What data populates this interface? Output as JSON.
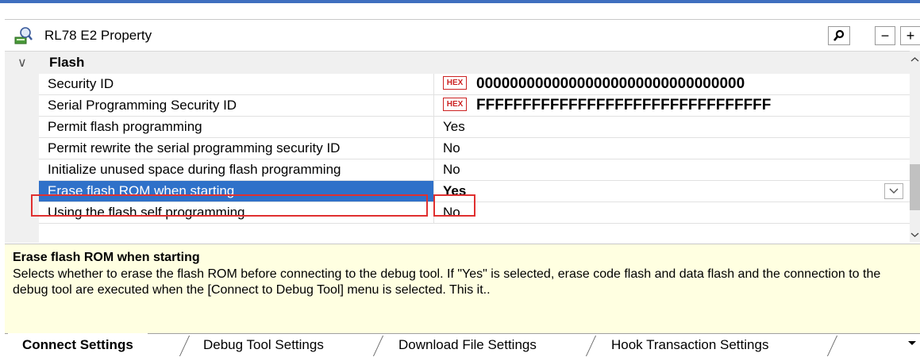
{
  "window": {
    "title": "RL78 E2 Property"
  },
  "toolbar": {
    "search_icon": "search-icon",
    "minus": "−",
    "plus": "+"
  },
  "category": {
    "label": "Flash",
    "chevron": "∨"
  },
  "rows": [
    {
      "name": "Security ID",
      "hex": "HEX",
      "value": "00000000000000000000000000000000"
    },
    {
      "name": "Serial Programming Security ID",
      "hex": "HEX",
      "value": "FFFFFFFFFFFFFFFFFFFFFFFFFFFFFFFF"
    },
    {
      "name": "Permit flash programming",
      "value": "Yes"
    },
    {
      "name": "Permit rewrite the serial programming security ID",
      "value": "No"
    },
    {
      "name": "Initialize unused space during flash programming",
      "value": "No"
    },
    {
      "name": "Erase flash ROM when starting",
      "value": "Yes"
    },
    {
      "name": "Using the flash self programming",
      "value": "No"
    }
  ],
  "description": {
    "title": "Erase flash ROM when starting",
    "text": "Selects whether to erase the flash ROM before connecting to the debug tool. If \"Yes\" is selected, erase code flash and data flash and the connection to the debug tool are executed when the [Connect to Debug Tool] menu is selected. This it.."
  },
  "tabs": [
    {
      "label": "Connect Settings"
    },
    {
      "label": "Debug Tool Settings"
    },
    {
      "label": "Download File Settings"
    },
    {
      "label": "Hook Transaction Settings"
    }
  ],
  "colors": {
    "selection": "#2f71c9",
    "highlight_border": "#e03030",
    "description_bg": "#ffffe1"
  }
}
